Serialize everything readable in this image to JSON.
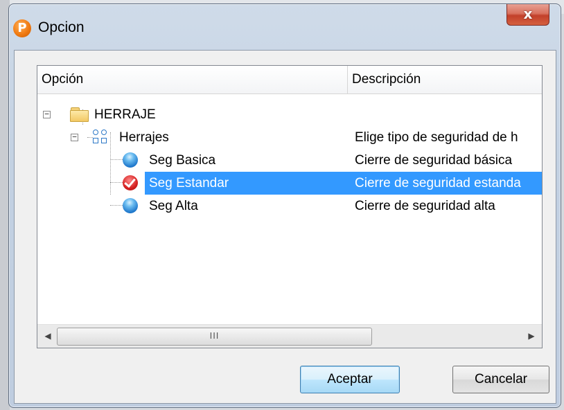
{
  "window": {
    "title": "Opcion",
    "close_label": "x"
  },
  "app": {
    "icon_letter": "P"
  },
  "listview": {
    "columns": [
      "Opción",
      "Descripción"
    ],
    "rows": [
      {
        "label": "HERRAJE",
        "description": "",
        "icon": "folder-icon",
        "level": 0
      },
      {
        "label": "Herrajes",
        "description": "Elige tipo de seguridad de h",
        "icon": "grid-icon",
        "level": 1
      },
      {
        "label": "Seg Basica",
        "description": "Cierre de seguridad básica",
        "icon": "blue-dot-icon",
        "level": 2
      },
      {
        "label": "Seg Estandar",
        "description": "Cierre de seguridad estanda",
        "icon": "red-check-icon",
        "level": 2,
        "selected": true
      },
      {
        "label": "Seg Alta",
        "description": "Cierre de seguridad alta",
        "icon": "blue-dot-icon",
        "level": 2
      }
    ],
    "scroll_thumb_grip": "III"
  },
  "buttons": {
    "accept": "Aceptar",
    "cancel": "Cancelar"
  },
  "colors": {
    "selection": "#3399ff",
    "close_button": "#c2402a"
  }
}
